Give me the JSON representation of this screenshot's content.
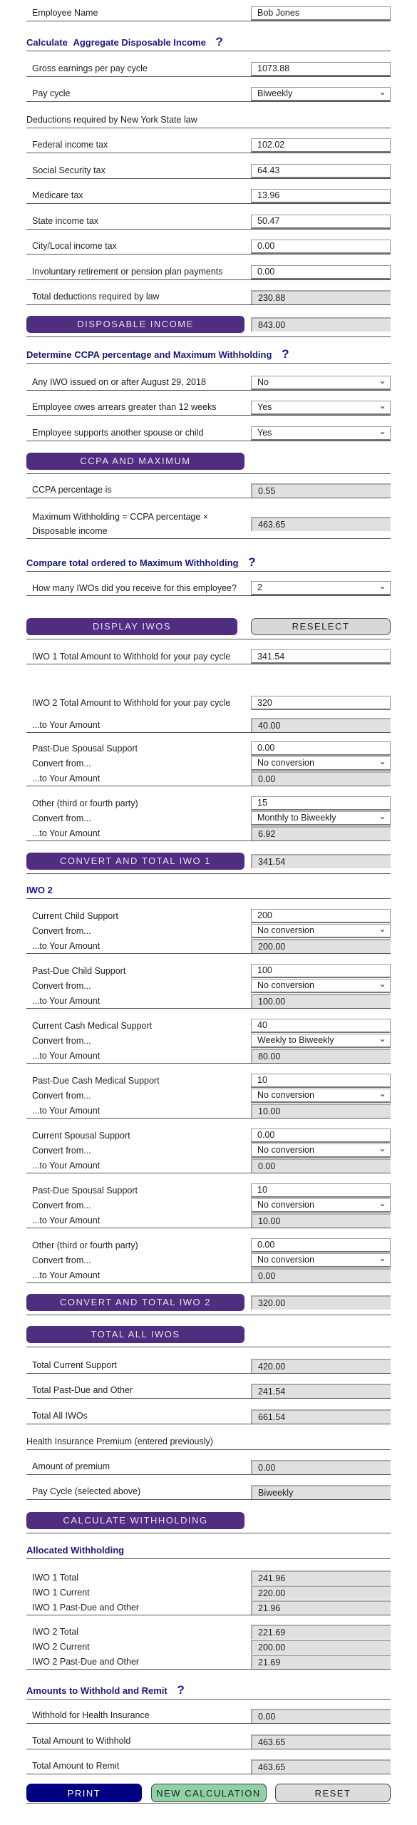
{
  "employee": {
    "label": "Employee Name",
    "value": "Bob Jones"
  },
  "adi": {
    "title_prefix": "Calculate",
    "title": "Aggregate Disposable Income",
    "help": "?",
    "gross": {
      "label": "Gross earnings per pay cycle",
      "value": "1073.88"
    },
    "pay_cycle": {
      "label": "Pay  cycle",
      "value": "Biweekly"
    },
    "deductions_title": "Deductions required by New York State law",
    "federal": {
      "label": "Federal income tax",
      "value": "102.02"
    },
    "ss": {
      "label": "Social Security tax",
      "value": "64.43"
    },
    "medicare": {
      "label": "Medicare tax",
      "value": "13.96"
    },
    "state": {
      "label": "State income tax",
      "value": "50.47"
    },
    "city": {
      "label": "City/Local income tax",
      "value": "0.00"
    },
    "retirement": {
      "label": "Involuntary retirement or pension plan payments",
      "value": "0.00"
    },
    "total_deductions": {
      "label": "Total deductions required by law",
      "value": "230.88"
    },
    "disposable_button": "DISPOSABLE INCOME",
    "disposable_value": "843.00"
  },
  "ccpa": {
    "title": "Determine CCPA  percentage and Maximum Withholding",
    "help": "?",
    "iwo_date": {
      "label": "Any IWO issued on or after August 29, 2018",
      "value": "No"
    },
    "arrears": {
      "label": "Employee owes arrears greater than 12 weeks",
      "value": "Yes"
    },
    "supports": {
      "label": "Employee supports another spouse or child",
      "value": "Yes"
    },
    "button": "CCPA AND MAXIMUM",
    "percentage": {
      "label": "CCPA percentage is",
      "value": "0.55"
    },
    "max": {
      "label": "Maximum Withholding = CCPA percentage × Disposable income",
      "value": "463.65"
    }
  },
  "compare": {
    "title": "Compare total ordered to Maximum Withholding",
    "help": "?",
    "how_many": {
      "label": "How many  IWOs did you receive for this employee?",
      "value": "2"
    },
    "display_button": "DISPLAY IWOS",
    "reselect_button": "RESELECT",
    "iwo1_total": {
      "label": "IWO 1 Total Amount to Withhold for your pay cycle",
      "value": "341.54"
    },
    "iwo2_total": {
      "label": "IWO 2 Total Amount to Withhold for your pay cycle",
      "value": "320",
      "to_label": "...to Your Amount",
      "to_value": "40.00"
    }
  },
  "iwo1_items": [
    {
      "label": "Past-Due Spousal Support",
      "value": "0.00",
      "convert_label": "Convert from...",
      "convert": "No conversion",
      "to_label": "...to Your Amount",
      "to_value": "0.00"
    },
    {
      "label": "Other (third or fourth party)",
      "value": "15",
      "convert_label": "Convert from...",
      "convert": "Monthly to Biweekly",
      "to_label": "...to Your Amount",
      "to_value": "6.92"
    }
  ],
  "iwo1_button": "CONVERT AND TOTAL IWO 1",
  "iwo1_result": "341.54",
  "iwo2": {
    "title": "IWO 2",
    "items": [
      {
        "label": "Current Child Support",
        "value": "200",
        "convert_label": "Convert from...",
        "convert": "No conversion",
        "to_label": "...to Your Amount",
        "to_value": "200.00"
      },
      {
        "label": "Past-Due Child Support",
        "value": "100",
        "convert_label": "Convert from...",
        "convert": "No conversion",
        "to_label": "...to Your Amount",
        "to_value": "100.00"
      },
      {
        "label": "Current Cash Medical Support",
        "value": "40",
        "convert_label": "Convert from...",
        "convert": "Weekly to Biweekly",
        "to_label": "...to Your Amount",
        "to_value": "80.00"
      },
      {
        "label": "Past-Due Cash Medical Support",
        "value": "10",
        "convert_label": "Convert from...",
        "convert": "No conversion",
        "to_label": "...to Your Amount",
        "to_value": "10.00"
      },
      {
        "label": "Current Spousal Support",
        "value": "0.00",
        "convert_label": "Convert from...",
        "convert": "No conversion",
        "to_label": "...to Your Amount",
        "to_value": "0.00"
      },
      {
        "label": "Past-Due Spousal Support",
        "value": "10",
        "convert_label": "Convert from...",
        "convert": "No conversion",
        "to_label": "...to Your Amount",
        "to_value": "10.00"
      },
      {
        "label": "Other (third or fourth party)",
        "value": "0.00",
        "convert_label": "Convert from...",
        "convert": "No conversion",
        "to_label": "...to Your Amount",
        "to_value": "0.00"
      }
    ],
    "button": "CONVERT AND TOTAL IWO 2",
    "result": "320.00"
  },
  "totals": {
    "button": "TOTAL ALL IWOS",
    "current": {
      "label": "Total Current Support",
      "value": "420.00"
    },
    "pastdue": {
      "label": "Total Past-Due and Other",
      "value": "241.54"
    },
    "all": {
      "label": "Total All IWOs",
      "value": "661.54"
    }
  },
  "health": {
    "title": "Health Insurance Premium (entered previously)",
    "premium": {
      "label": "Amount of premium",
      "value": "0.00"
    },
    "cycle": {
      "label": "Pay Cycle (selected above)",
      "value": "Biweekly"
    },
    "button": "CALCULATE WITHHOLDING"
  },
  "allocated": {
    "title": "Allocated Withholding",
    "iwo1": [
      {
        "label": "IWO 1 Total",
        "value": "241.96"
      },
      {
        "label": "IWO 1 Current",
        "value": "220.00"
      },
      {
        "label": "IWO 1 Past-Due and Other",
        "value": "21.96"
      }
    ],
    "iwo2": [
      {
        "label": "IWO 2 Total",
        "value": "221.69"
      },
      {
        "label": "IWO 2 Current",
        "value": "200.00"
      },
      {
        "label": "IWO 2 Past-Due and Other",
        "value": "21.69"
      }
    ]
  },
  "remit": {
    "title": "Amounts to Withhold and Remit",
    "help": "?",
    "health": {
      "label": "Withhold for Health Insurance",
      "value": "0.00"
    },
    "withhold": {
      "label": "Total Amount to Withhold",
      "value": "463.65"
    },
    "remit": {
      "label": "Total Amount to Remit",
      "value": "463.65"
    }
  },
  "actions": {
    "print": "PRINT",
    "new": "NEW CALCULATION",
    "reset": "RESET"
  }
}
